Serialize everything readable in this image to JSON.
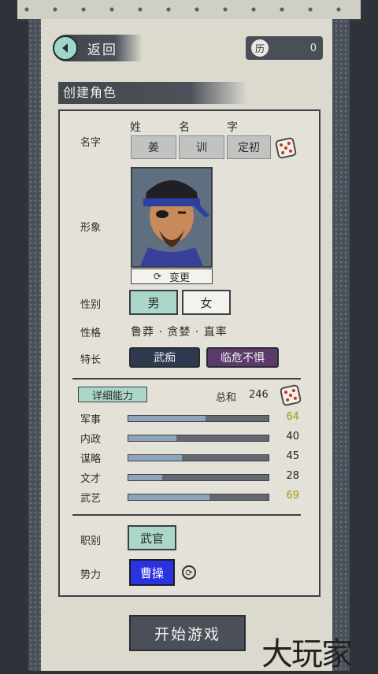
{
  "header": {
    "back_label": "返回",
    "currency_icon": "历",
    "currency_value": "0"
  },
  "section_title": "创建角色",
  "name": {
    "label": "名字",
    "col_surname": "姓",
    "col_given": "名",
    "col_courtesy": "字",
    "surname": "姜",
    "given": "训",
    "courtesy": "定初"
  },
  "appearance": {
    "label": "形象",
    "change_label": "变更"
  },
  "gender": {
    "label": "性别",
    "male": "男",
    "female": "女"
  },
  "personality": {
    "label": "性格",
    "value": "鲁莽 · 贪婪 · 直率"
  },
  "specialty": {
    "label": "特长",
    "tag1": "武痴",
    "tag2": "临危不惧"
  },
  "abilities": {
    "detail_label": "详细能力",
    "total_label": "总和",
    "total_value": "246",
    "stats": [
      {
        "name": "军事",
        "value": "64",
        "fill": 0.55,
        "color": "#e8e44a"
      },
      {
        "name": "内政",
        "value": "40",
        "fill": 0.34,
        "color": "#f2f2f2"
      },
      {
        "name": "谋略",
        "value": "45",
        "fill": 0.38,
        "color": "#f2f2f2"
      },
      {
        "name": "文才",
        "value": "28",
        "fill": 0.24,
        "color": "#d6d6d6"
      },
      {
        "name": "武艺",
        "value": "69",
        "fill": 0.58,
        "color": "#e8e44a"
      }
    ]
  },
  "role": {
    "label": "职别",
    "value": "武官"
  },
  "faction": {
    "label": "势力",
    "value": "曹操"
  },
  "start_button": "开始游戏",
  "watermark": "大玩家"
}
